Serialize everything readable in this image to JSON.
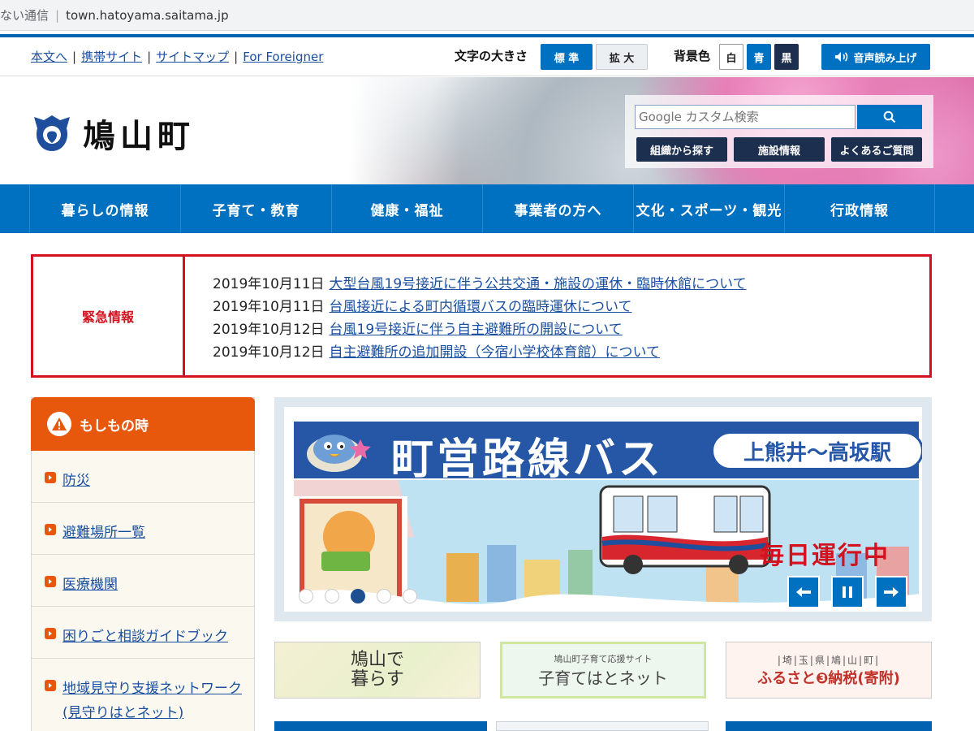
{
  "browser": {
    "security": "ない通信",
    "url": "town.hatoyama.saitama.jp"
  },
  "utility": {
    "links": [
      "本文へ",
      "携帯サイト",
      "サイトマップ",
      "For Foreigner"
    ],
    "font_size_label": "文字の大きさ",
    "font_standard": "標 準",
    "font_large": "拡 大",
    "bg_label": "背景色",
    "bg_white": "白",
    "bg_blue": "青",
    "bg_black": "黒",
    "voice": "音声読み上げ"
  },
  "header": {
    "site_name": "鳩山町",
    "search_placeholder": "Google カスタム検索",
    "buttons": [
      "組織から探す",
      "施設情報",
      "よくあるご質問"
    ]
  },
  "nav": {
    "items": [
      "暮らしの情報",
      "子育て・教育",
      "健康・福祉",
      "事業者の方へ",
      "文化・スポーツ・観光",
      "行政情報"
    ]
  },
  "emergency": {
    "label": "緊急情報",
    "items": [
      {
        "date": "2019年10月11日",
        "text": "大型台風19号接近に伴う公共交通・施設の運休・臨時休館について"
      },
      {
        "date": "2019年10月11日",
        "text": "台風接近による町内循環バスの臨時運休について"
      },
      {
        "date": "2019年10月12日",
        "text": "台風19号接近に伴う自主避難所の開設について"
      },
      {
        "date": "2019年10月12日",
        "text": "自主避難所の追加開設（今宿小学校体育館）について"
      }
    ]
  },
  "sidebar": {
    "title": "もしもの時",
    "items": [
      "防災",
      "避難場所一覧",
      "医療機関",
      "困りごと相談ガイドブック",
      "地域見守り支援ネットワーク(見守りはとネット)"
    ]
  },
  "slideshow": {
    "title": "町営路線バス",
    "route": "上熊井～高坂駅",
    "tagline": "毎日運行中",
    "active_slide": 3,
    "slide_count": 5
  },
  "banners": {
    "b1_line1": "鳩山で",
    "b1_line2": "暮らす",
    "b2_sub": "鳩山町子育て応援サイト",
    "b2_main": "子育てはとネット",
    "b3_sub": "|埼|玉|県|鳩|山|町|",
    "b3_main": "ふるさと❸納税(寄附)"
  },
  "colors": {
    "brand_blue": "#0070c0",
    "emergency_red": "#d4121f",
    "accent_orange": "#e8580c",
    "navy": "#1d2f4f"
  }
}
